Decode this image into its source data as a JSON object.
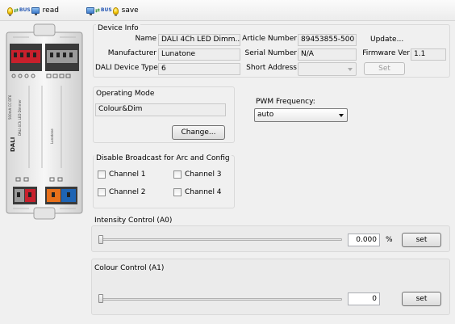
{
  "toolbar": {
    "read_label": "read",
    "save_label": "save"
  },
  "device_info": {
    "title": "Device Info",
    "name_label": "Name",
    "name_value": "DALI 4Ch LED Dimm...",
    "manufacturer_label": "Manufacturer",
    "manufacturer_value": "Lunatone",
    "device_type_label": "DALI Device Type",
    "device_type_value": "6",
    "article_label": "Article Number",
    "article_value": "89453855-500",
    "serial_label": "Serial Number",
    "serial_value": "N/A",
    "short_address_label": "Short Address",
    "short_address_value": "",
    "update_label": "Update...",
    "firmware_label": "Firmware Ver",
    "firmware_value": "1.1",
    "set_label": "Set"
  },
  "operating_mode": {
    "title": "Operating Mode",
    "value": "Colour&Dim",
    "change_label": "Change..."
  },
  "pwm": {
    "label": "PWM Frequency:",
    "selected": "auto"
  },
  "broadcast": {
    "title": "Disable Broadcast  for Arc and Config",
    "channels": [
      "Channel 1",
      "Channel 2",
      "Channel 3",
      "Channel 4"
    ]
  },
  "intensity": {
    "title": "Intensity Control (A0)",
    "value": "0.000",
    "unit": "%",
    "level": 0,
    "set_label": "set"
  },
  "colour": {
    "title": "Colour Control (A1)",
    "value": "0",
    "level": 0,
    "set_label": "set"
  },
  "colors": {
    "accent": "#2a5bb5",
    "terminal_red": "#c8202c",
    "terminal_orange": "#e8701a",
    "terminal_blue": "#1e64b4"
  }
}
